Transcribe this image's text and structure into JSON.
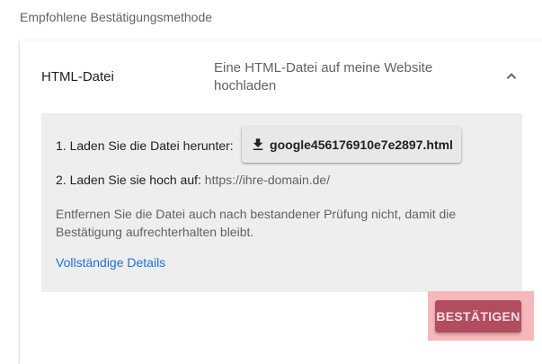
{
  "section": {
    "title": "Empfohlene Bestätigungsmethode"
  },
  "method": {
    "name": "HTML-Datei",
    "description": "Eine HTML-Datei auf meine Website hochladen",
    "toggle_icon": "chevron-up-icon"
  },
  "instructions": {
    "step1_label": "1. Laden Sie die Datei herunter:",
    "download_icon": "download-icon",
    "download_filename": "google456176910e7e2897.html",
    "step2_label": "2. Laden Sie sie hoch auf:",
    "step2_url": "https://ihre-domain.de/",
    "info_text": "Entfernen Sie die Datei auch nach bestandener Prüfung nicht, damit die Bestätigung aufrechterhalten bleibt.",
    "details_link": "Vollständige Details"
  },
  "actions": {
    "confirm_label": "BESTÄTIGEN"
  },
  "colors": {
    "link": "#1a73e8",
    "confirm_button": "#b24d60",
    "highlight": "#f8b8bb",
    "panel_background": "#eeeeee"
  }
}
